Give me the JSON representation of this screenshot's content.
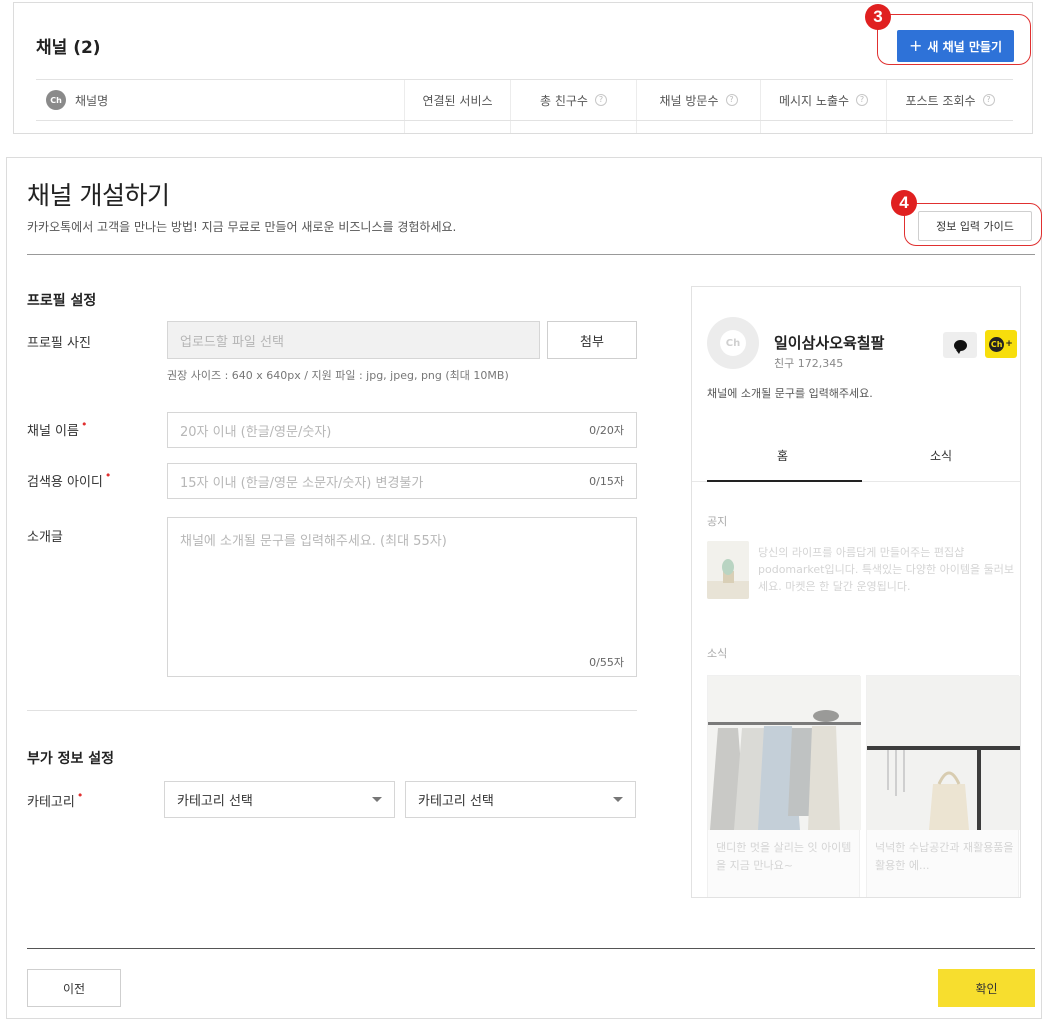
{
  "channel_list": {
    "title": "채널 (2)",
    "new_channel_button": "새 채널 만들기",
    "columns": [
      "채널명",
      "연결된 서비스",
      "총 친구수",
      "채널 방문수",
      "메시지 노출수",
      "포스트 조회수"
    ],
    "channel_icon_label": "Ch"
  },
  "markers": {
    "m3": "3",
    "m4": "4"
  },
  "create": {
    "title": "채널 개설하기",
    "subtitle": "카카오톡에서 고객을 만나는 방법! 지금 무료로 만들어 새로운 비즈니스를 경험하세요.",
    "guide_button": "정보 입력 가이드",
    "profile_section": "프로필 설정",
    "photo_label": "프로필 사진",
    "photo_placeholder": "업로드할 파일 선택",
    "attach_button": "첨부",
    "photo_hint": "권장 사이즈 : 640 x 640px / 지원 파일 : jpg, jpeg, png (최대 10MB)",
    "name_label": "채널 이름",
    "name_placeholder": "20자 이내 (한글/영문/숫자)",
    "name_counter": "0/20자",
    "id_label": "검색용 아이디",
    "id_placeholder": "15자 이내 (한글/영문 소문자/숫자) 변경불가",
    "id_counter": "0/15자",
    "intro_label": "소개글",
    "intro_placeholder": "채널에 소개될 문구를 입력해주세요. (최대 55자)",
    "intro_counter": "0/55자",
    "extra_section": "부가 정보 설정",
    "category_label": "카테고리",
    "category_select_1": "카테고리 선택",
    "category_select_2": "카테고리 선택",
    "required_mark": "•",
    "prev_button": "이전",
    "confirm_button": "확인"
  },
  "preview": {
    "avatar_label": "Ch",
    "name": "일이삼사오육칠팔",
    "friends": "친구 172,345",
    "description": "채널에 소개될 문구를 입력해주세요.",
    "add_icon_label": "Ch",
    "tab_home": "홈",
    "tab_news": "소식",
    "notice_label": "공지",
    "notice_text": "당신의 라이프를 아름답게 만들어주는 편집샵 podomarket입니다. 특색있는 다양한 아이템을 둘러보세요. 마켓은 한 달간 운영됩니다.",
    "news_label": "소식",
    "card1_text": "댄디한 멋을 살리는 잇 아이템을 지금 만나요~",
    "card2_text": "넉넉한 수납공간과 재활용품을 활용한 에..."
  },
  "colors": {
    "primary_blue": "#2e72d8",
    "accent_yellow": "#f7de2e",
    "marker_red": "#e02020"
  }
}
